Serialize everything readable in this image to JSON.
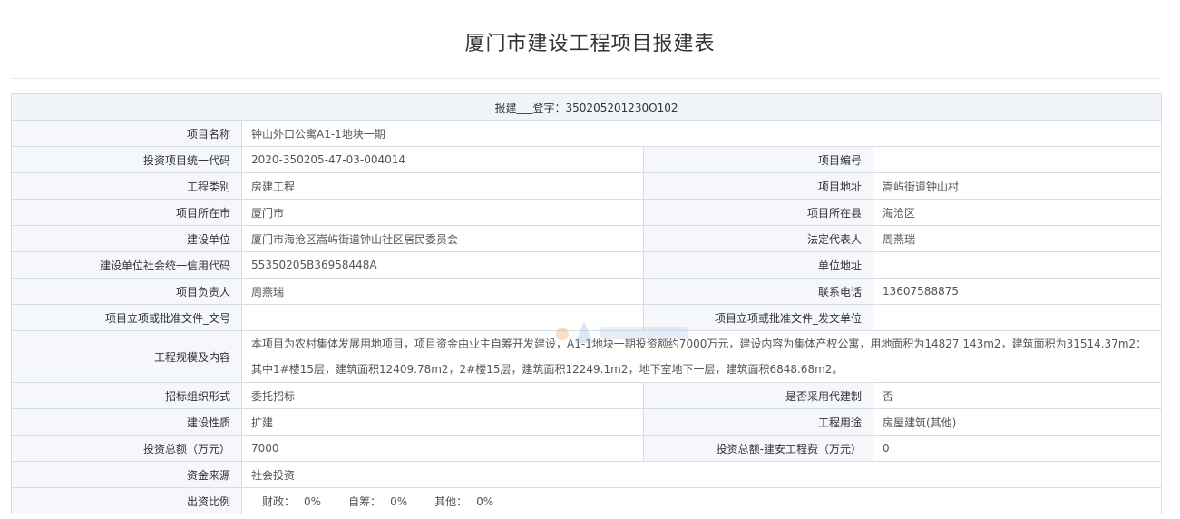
{
  "page": {
    "title": "厦门市建设工程项目报建表"
  },
  "registration": {
    "text": "报建___登字：350205201230O102"
  },
  "rows": {
    "project_name": {
      "label": "项目名称",
      "value": "钟山外口公寓A1-1地块一期"
    },
    "investment_code": {
      "label": "投资项目统一代码",
      "value": "2020-350205-47-03-004014"
    },
    "project_number": {
      "label": "项目编号",
      "value": ""
    },
    "engineering_category": {
      "label": "工程类别",
      "value": "房建工程"
    },
    "project_address": {
      "label": "项目地址",
      "value": "嵩屿街道钟山村"
    },
    "project_city": {
      "label": "项目所在市",
      "value": "厦门市"
    },
    "project_county": {
      "label": "项目所在县",
      "value": "海沧区"
    },
    "construction_unit": {
      "label": "建设单位",
      "value": "厦门市海沧区嵩屿街道钟山社区居民委员会"
    },
    "legal_representative": {
      "label": "法定代表人",
      "value": "周燕瑞"
    },
    "credit_code": {
      "label": "建设单位社会统一信用代码",
      "value": "55350205B36958448A"
    },
    "unit_address": {
      "label": "单位地址",
      "value": ""
    },
    "project_leader": {
      "label": "项目负责人",
      "value": "周燕瑞"
    },
    "contact_phone": {
      "label": "联系电话",
      "value": "13607588875"
    },
    "approval_doc_no": {
      "label": "项目立项或批准文件_文号",
      "value": ""
    },
    "approval_issuer": {
      "label": "项目立项或批准文件_发文单位",
      "value": ""
    },
    "scale_content": {
      "label": "工程规模及内容",
      "value": "本项目为农村集体发展用地项目，项目资金由业主自筹开发建设，A1-1地块一期投资额约7000万元，建设内容为集体产权公寓，用地面积为14827.143m2，建筑面积为31514.37m2：其中1#楼15层，建筑面积12409.78m2，2#楼15层，建筑面积12249.1m2，地下室地下一层，建筑面积6848.68m2。"
    },
    "bidding_form": {
      "label": "招标组织形式",
      "value": "委托招标"
    },
    "agent_construction": {
      "label": "是否采用代建制",
      "value": "否"
    },
    "construction_nature": {
      "label": "建设性质",
      "value": "扩建"
    },
    "engineering_use": {
      "label": "工程用途",
      "value": "房屋建筑(其他)"
    },
    "total_investment": {
      "label": "投资总额（万元）",
      "value": "7000"
    },
    "installation_cost": {
      "label": "投资总额-建安工程费（万元）",
      "value": "0"
    },
    "fund_source": {
      "label": "资金来源",
      "value": "社会投资"
    },
    "funding_ratio": {
      "label": "出资比例",
      "finance_label": "财政：",
      "finance_value": "0%",
      "self_label": "自筹：",
      "self_value": "0%",
      "other_label": "其他：",
      "other_value": "0%"
    }
  }
}
